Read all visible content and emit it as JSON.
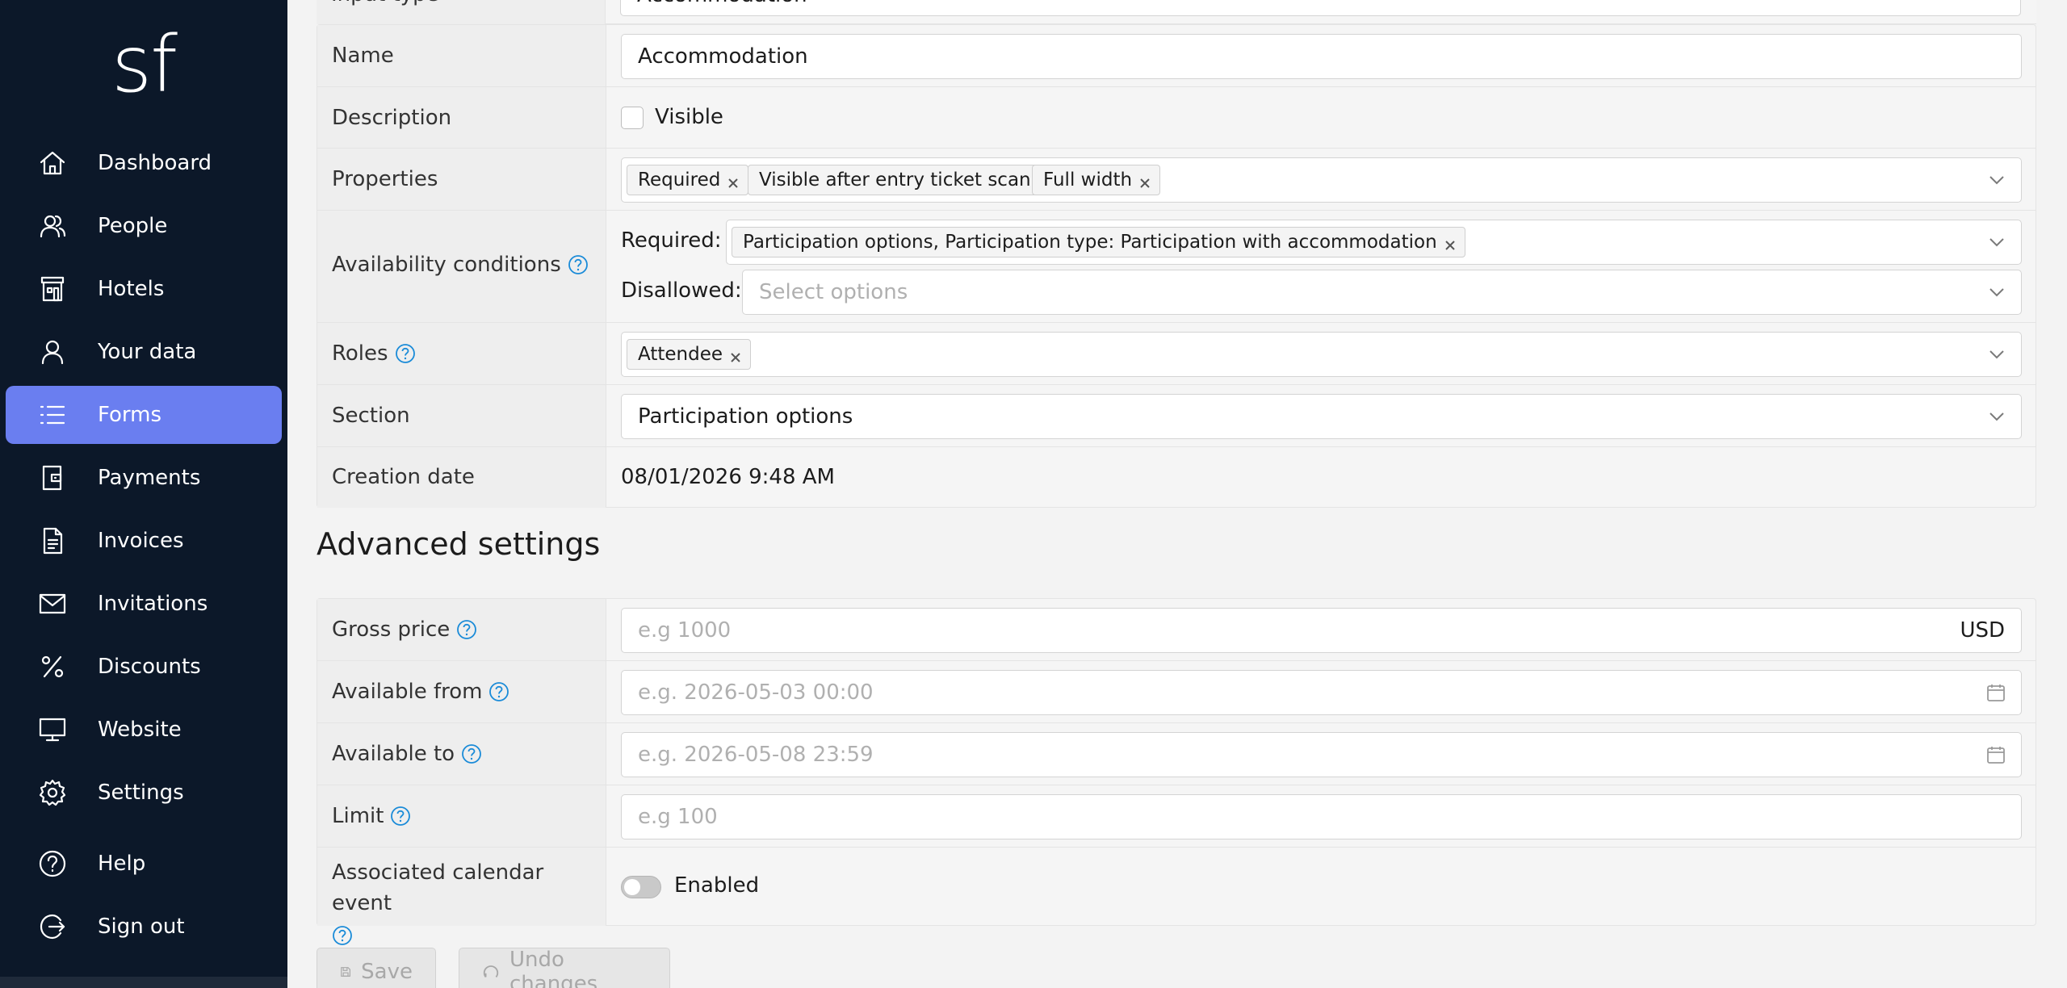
{
  "logo": "sf",
  "nav": [
    {
      "label": "Dashboard",
      "icon": "home-icon",
      "active": false
    },
    {
      "label": "People",
      "icon": "people-icon",
      "active": false
    },
    {
      "label": "Hotels",
      "icon": "hotel-icon",
      "active": false
    },
    {
      "label": "Your data",
      "icon": "user-icon",
      "active": false
    },
    {
      "label": "Forms",
      "icon": "list-icon",
      "active": true
    },
    {
      "label": "Payments",
      "icon": "wallet-icon",
      "active": false
    },
    {
      "label": "Invoices",
      "icon": "document-icon",
      "active": false
    },
    {
      "label": "Invitations",
      "icon": "mail-icon",
      "active": false
    },
    {
      "label": "Discounts",
      "icon": "percent-icon",
      "active": false
    },
    {
      "label": "Website",
      "icon": "monitor-icon",
      "active": false
    },
    {
      "label": "Settings",
      "icon": "gear-icon",
      "active": false
    },
    {
      "label": "Help",
      "icon": "help-circle-icon",
      "active": false
    },
    {
      "label": "Sign out",
      "icon": "sign-out-icon",
      "active": false
    }
  ],
  "top": {
    "input_type_label": "Input type",
    "input_type_value": "Accommodation"
  },
  "form": {
    "name": {
      "label": "Name",
      "value": "Accommodation"
    },
    "description": {
      "label": "Description",
      "checkbox_label": "Visible",
      "checked": false
    },
    "properties": {
      "label": "Properties",
      "tags": [
        "Required",
        "Visible after entry ticket scan",
        "Full width"
      ]
    },
    "availability": {
      "label": "Availability conditions",
      "required_label": "Required:",
      "required_tags": [
        "Participation options, Participation type: Participation with accommodation"
      ],
      "disallowed_label": "Disallowed:",
      "disallowed_placeholder": "Select options"
    },
    "roles": {
      "label": "Roles",
      "tags": [
        "Attendee"
      ]
    },
    "section": {
      "label": "Section",
      "value": "Participation options"
    },
    "creation_date": {
      "label": "Creation date",
      "value": "08/01/2026 9:48 AM"
    }
  },
  "advanced": {
    "title": "Advanced settings",
    "gross_price": {
      "label": "Gross price",
      "placeholder": "e.g 1000",
      "currency": "USD"
    },
    "available_from": {
      "label": "Available from",
      "placeholder": "e.g. 2026-05-03 00:00"
    },
    "available_to": {
      "label": "Available to",
      "placeholder": "e.g. 2026-05-08 23:59"
    },
    "limit": {
      "label": "Limit",
      "placeholder": "e.g 100"
    },
    "calendar_event": {
      "label": "Associated calendar event",
      "toggle_label": "Enabled",
      "enabled": false
    }
  },
  "buttons": {
    "save": "Save",
    "undo": "Undo changes"
  },
  "colors": {
    "sidebar_bg": "#0c1829",
    "active_nav": "#6a7ef0",
    "help_icon": "#1a8bd8"
  }
}
